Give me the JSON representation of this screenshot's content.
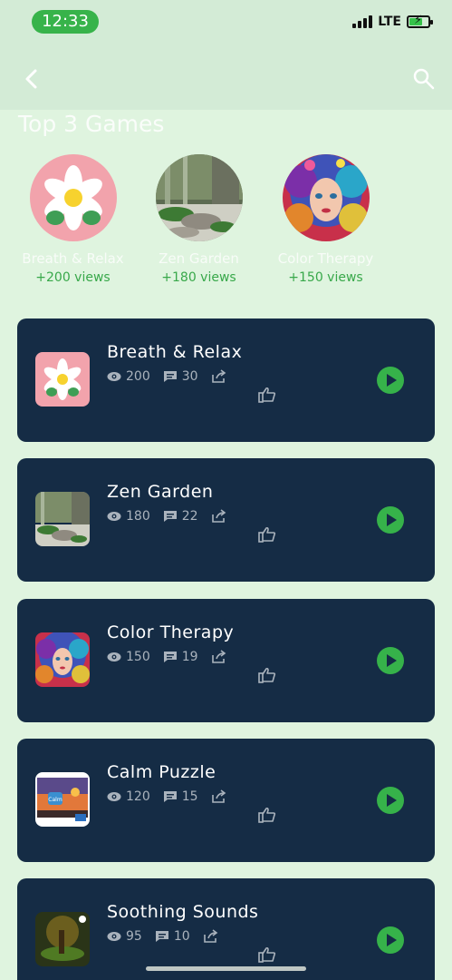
{
  "status_bar": {
    "time": "12:33",
    "network": "LTE"
  },
  "header": {
    "back_icon": "chevron-left-icon",
    "search_icon": "search-icon"
  },
  "top_section": {
    "title": "Top 3 Games",
    "items": [
      {
        "name": "Breath & Relax",
        "views": "+200 views",
        "image": "lotus-flower"
      },
      {
        "name": "Zen Garden",
        "views": "+180 views",
        "image": "zen-garden-stones"
      },
      {
        "name": "Color Therapy",
        "views": "+150 views",
        "image": "colorful-woman-portrait"
      }
    ]
  },
  "games": [
    {
      "title": "Breath & Relax",
      "views": "200",
      "comments": "30",
      "image": "lotus-flower"
    },
    {
      "title": "Zen Garden",
      "views": "180",
      "comments": "22",
      "image": "zen-garden-stones"
    },
    {
      "title": "Color Therapy",
      "views": "150",
      "comments": "19",
      "image": "colorful-woman-portrait"
    },
    {
      "title": "Calm Puzzle",
      "views": "120",
      "comments": "15",
      "image": "calm-app-sunset"
    },
    {
      "title": "Soothing Sounds",
      "views": "95",
      "comments": "10",
      "image": "mystic-forest"
    }
  ],
  "colors": {
    "background": "#dff4df",
    "app_bar": "#d3ebd6",
    "card": "#152c45",
    "accent_green": "#36b24a",
    "views_green": "#38a84a"
  }
}
